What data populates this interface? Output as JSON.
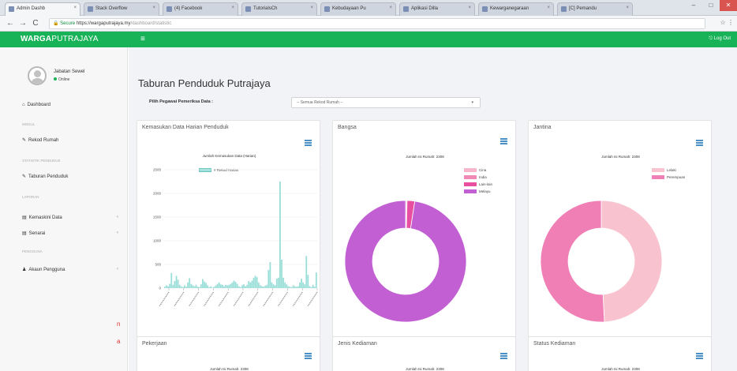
{
  "browser": {
    "tabs": [
      {
        "label": "Admin Dashb"
      },
      {
        "label": "Stack Overflow"
      },
      {
        "label": "(4) Facebook"
      },
      {
        "label": "TutorialsCh"
      },
      {
        "label": "Kebudayaan Pu"
      },
      {
        "label": "Aplikasi Dilla"
      },
      {
        "label": "Kewarganegaraan"
      },
      {
        "label": "[C] Pemandu"
      }
    ],
    "window_controls": {
      "minimize": "–",
      "maximize": "□",
      "close": "✕"
    },
    "nav": {
      "back": "←",
      "forward": "→",
      "reload": "C"
    },
    "address": {
      "secure_label": "Secure",
      "url": "https://wargaputrajaya.my",
      "path": "/dashboard/statistic"
    },
    "addr_right": "☆ ⋮"
  },
  "app": {
    "brand_bold": "WARGA",
    "brand_rest": "PUTRAJAYA",
    "hamburger": "≡",
    "logout": "⎋ Log Out"
  },
  "sidebar": {
    "user_name": "Jabatan Sewel",
    "user_status": "Online",
    "items": [
      {
        "label": "Dashboard",
        "icon": "home-icon",
        "glyph": "⌂"
      },
      {
        "section": "MODUL"
      },
      {
        "label": "Rekod Rumah",
        "icon": "wrench-icon",
        "glyph": "✎"
      },
      {
        "section": "STATISTIK PENDUDUK"
      },
      {
        "label": "Taburan Penduduk",
        "icon": "chart-icon",
        "glyph": "✎"
      },
      {
        "section": "LAPORAN"
      },
      {
        "label": "Kemaskini Data",
        "icon": "table-icon",
        "glyph": "▤",
        "chevron": "‹"
      },
      {
        "label": "Senarai",
        "icon": "list-icon",
        "glyph": "▤",
        "chevron": "‹"
      },
      {
        "section": "PENGGUNA"
      },
      {
        "label": "Akaun Pengguna",
        "icon": "user-icon",
        "glyph": "♟",
        "chevron": "‹"
      }
    ]
  },
  "main": {
    "page_title": "Taburan Penduduk Putrajaya",
    "filter_label": "Pilih Pegawai Pemeriksa Data :",
    "filter_value": "-- Semua Rekod Rumah --",
    "cards": {
      "kemasukan": {
        "title": "Kemasukan Data Harian Penduduk",
        "chart_title": "Jumlah Kemasukan Data (Harian)",
        "legend": "# Rekod Harian"
      },
      "bangsa": {
        "title": "Bangsa",
        "chart_title": "Jumlah Isi Rumah: 2308",
        "legend": [
          "Cina",
          "India",
          "Lain-lain",
          "Melayu"
        ]
      },
      "jantina": {
        "title": "Jantina",
        "chart_title": "Jumlah Isi Rumah: 2308",
        "legend": [
          "Lelaki",
          "Perempuan"
        ]
      },
      "pekerjaan": {
        "title": "Pekerjaan",
        "chart_title": "Jumlah Isi Rumah: 2308"
      },
      "jenis_kediaman": {
        "title": "Jenis Kediaman",
        "chart_title": "Jumlah Isi Rumah: 2308"
      },
      "status_kediaman": {
        "title": "Status Kediaman",
        "chart_title": "Jumlah Isi Rumah: 2308"
      }
    }
  },
  "corner_text": [
    "n",
    "a"
  ],
  "colors": {
    "brand_green": "#18b258",
    "bar_teal": "#99ded8",
    "cina": "#f7b6cb",
    "india": "#f08ab4",
    "lain_lain": "#e84fa0",
    "melayu": "#c25fd3",
    "lelaki": "#f8c3cf",
    "perempuan": "#f07fb6"
  },
  "chart_data": [
    {
      "type": "bar",
      "title": "Jumlah Kemasukan Data (Harian)",
      "legend": [
        "# Rekod Harian"
      ],
      "ylim": [
        0,
        2500
      ],
      "yticks": [
        0,
        500,
        1000,
        1500,
        2000,
        2500
      ],
      "xtick_labels": [
        "",
        "",
        "",
        "",
        "",
        "",
        "",
        "",
        "",
        "",
        ""
      ],
      "values": [
        30,
        60,
        40,
        90,
        320,
        70,
        150,
        260,
        180,
        70,
        40,
        20,
        60,
        30,
        120,
        210,
        90,
        60,
        40,
        70,
        30,
        20,
        80,
        190,
        140,
        110,
        60,
        20,
        40,
        10,
        30,
        60,
        90,
        120,
        80,
        70,
        40,
        70,
        60,
        70,
        90,
        120,
        160,
        130,
        90,
        40,
        20,
        60,
        80,
        40,
        70,
        150,
        120,
        160,
        220,
        260,
        230,
        120,
        60,
        40,
        30,
        50,
        70,
        380,
        550,
        120,
        80,
        60,
        200,
        220,
        2250,
        600,
        220,
        120,
        80,
        40,
        30,
        20,
        60,
        40,
        30,
        40,
        120,
        200,
        120,
        80,
        680,
        280,
        40,
        20,
        70,
        30,
        330
      ]
    },
    {
      "type": "pie",
      "donut": true,
      "title": "Jumlah Isi Rumah: 2308",
      "categories": [
        "Cina",
        "India",
        "Lain-lain",
        "Melayu"
      ],
      "values": [
        8,
        1,
        47,
        2252
      ]
    },
    {
      "type": "pie",
      "donut": true,
      "title": "Jumlah Isi Rumah: 2308",
      "categories": [
        "Lelaki",
        "Perempuan"
      ],
      "values": [
        1135,
        1173
      ]
    }
  ]
}
